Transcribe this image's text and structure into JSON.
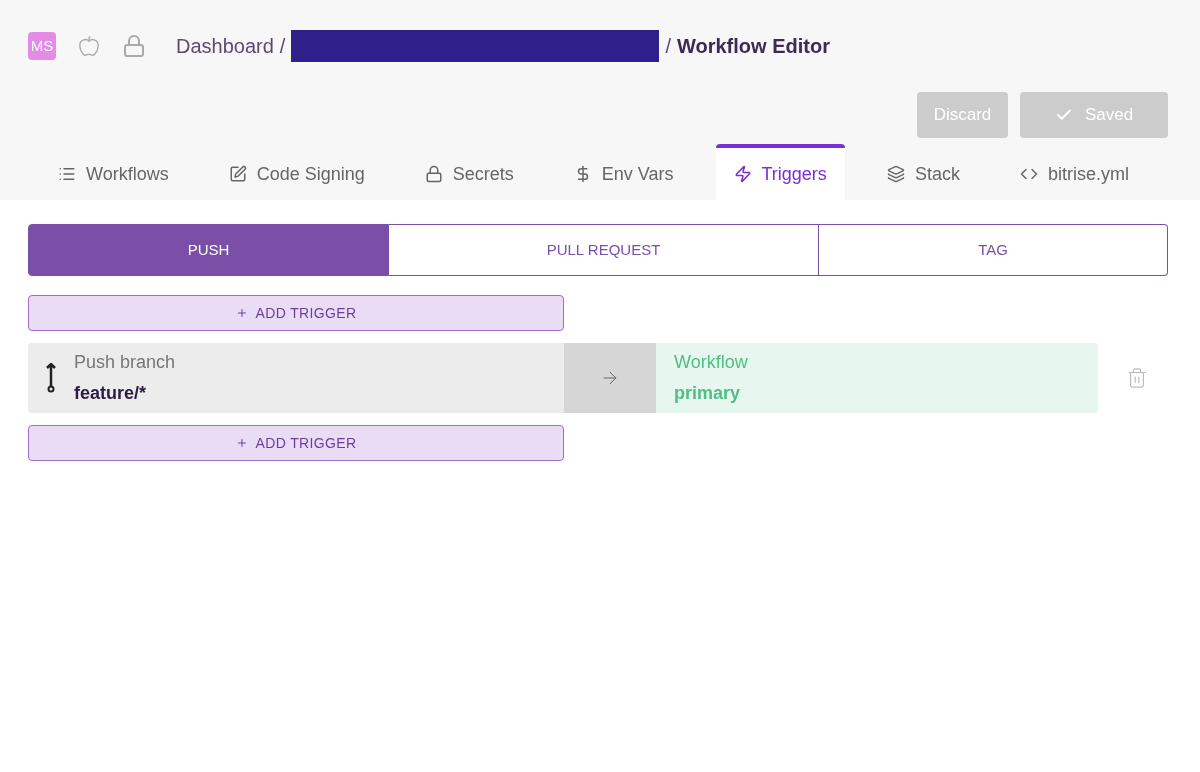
{
  "header": {
    "avatar": "MS",
    "breadcrumb": [
      {
        "kind": "link",
        "text": "Dashboard"
      },
      {
        "kind": "separator",
        "text": "/"
      },
      {
        "kind": "redacted"
      },
      {
        "kind": "separator",
        "text": "/"
      },
      {
        "kind": "current",
        "text": "Workflow Editor"
      }
    ]
  },
  "actions": [
    {
      "kind": "discard",
      "label": "Discard",
      "disabled": true
    },
    {
      "kind": "saved",
      "label": "Saved",
      "disabled": true
    }
  ],
  "tabs": [
    {
      "label": "Workflows",
      "selected": false
    },
    {
      "label": "Code Signing",
      "selected": false
    },
    {
      "label": "Secrets",
      "selected": false
    },
    {
      "label": "Env Vars",
      "selected": false
    },
    {
      "label": "Triggers",
      "selected": true
    },
    {
      "label": "Stack",
      "selected": false
    },
    {
      "label": "bitrise.yml",
      "selected": false
    }
  ],
  "trigger_types": [
    {
      "label": "PUSH",
      "selected": true
    },
    {
      "label": "PULL REQUEST",
      "selected": false
    },
    {
      "label": "TAG",
      "selected": false
    }
  ],
  "add_trigger_top": {
    "label": "ADD TRIGGER"
  },
  "triggers": [
    {
      "source_label": "Push branch",
      "source_value": "feature/*",
      "target_label": "Workflow",
      "target_value": "primary"
    }
  ],
  "add_trigger_bottom": {
    "label": "ADD TRIGGER"
  }
}
